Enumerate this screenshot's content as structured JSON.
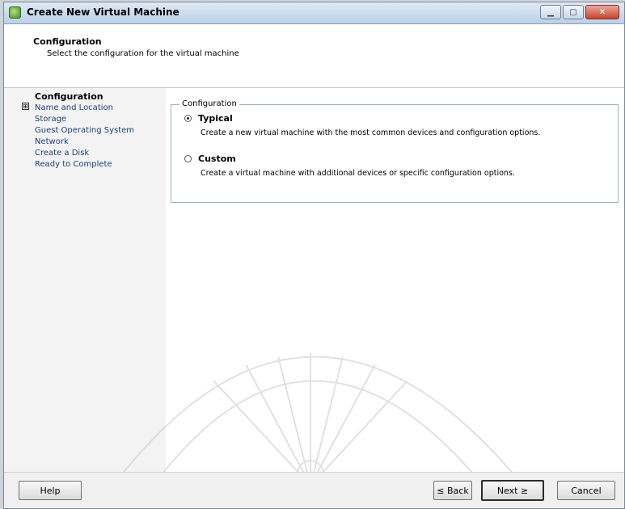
{
  "window": {
    "title": "Create New Virtual Machine",
    "controls": [
      "minimize",
      "maximize",
      "close"
    ]
  },
  "header": {
    "title": "Configuration",
    "subtitle": "Select the configuration for the virtual machine"
  },
  "steps": {
    "current": "Configuration",
    "items": [
      "Name and Location",
      "Storage",
      "Guest Operating System",
      "Network",
      "Create a Disk",
      "Ready to Complete"
    ],
    "expand_symbol": "⊞"
  },
  "configuration": {
    "group_label": "Configuration",
    "selected": "Typical",
    "options": [
      {
        "label": "Typical",
        "description": "Create a new virtual machine with the most common devices and configuration options."
      },
      {
        "label": "Custom",
        "description": "Create a virtual machine with additional devices or specific configuration options."
      }
    ]
  },
  "footer": {
    "help_label": "Help",
    "back_label": "≤ Back",
    "next_label": "Next ≥",
    "cancel_label": "Cancel"
  },
  "icons": {
    "app_icon": "vm-app-icon",
    "minimize": "minimize-icon",
    "maximize": "maximize-icon",
    "close": "close-icon"
  },
  "colors": {
    "titlebar": "#c8d8ea",
    "link_text": "#1b3f7a",
    "group_border": "#9db2c8"
  }
}
